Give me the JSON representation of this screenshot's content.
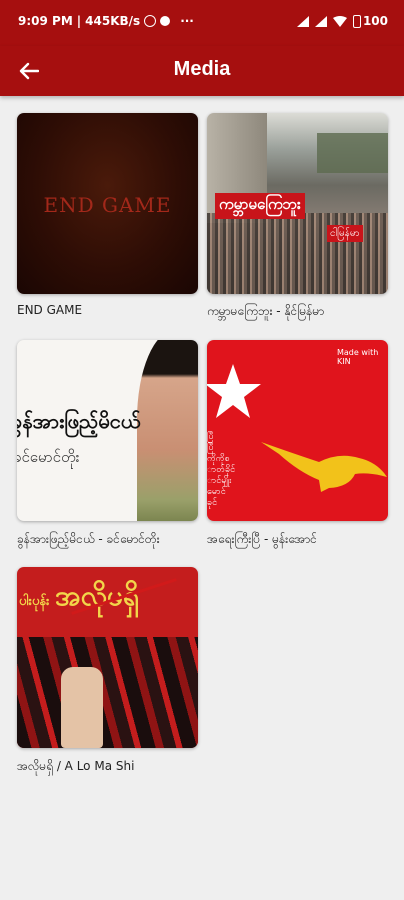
{
  "status": {
    "time": "9:09 PM",
    "speed": "445KB/s",
    "more": "···",
    "battery": "100"
  },
  "header": {
    "title": "Media"
  },
  "items": [
    {
      "title": "END GAME",
      "thumb_text": "END GAME"
    },
    {
      "title": "ကမ္ဘာမကြေဘူး - နိုင်မြန်မာ",
      "thumb_text": "ကမ္ဘာမကြေဘူး",
      "thumb_sub": "ငါမြန်မာ"
    },
    {
      "title": "ခွန်အားဖြည့်မိငယ် - ခင်မောင်တိုး",
      "thumb_text": "ခွန်အားဖြည့်မိငယ်",
      "thumb_sub": "ခင်မောင်တိုး"
    },
    {
      "title": "အရေးကြီးပြီ - မွန်းအောင်",
      "thumb_text": "Made with KIN",
      "thumb_lines": [
        "ပြီ",
        "ပြီ",
        "ကိုကိုစ",
        "ာတ်ခိုင်",
        "ာင်မျိုး",
        "မောင်",
        "ခုင်"
      ]
    },
    {
      "title": "အလိုမရှိ / A Lo Ma Shi",
      "thumb_text": "အလိုမရှိ",
      "thumb_side": "ပါးပုန်း"
    }
  ]
}
